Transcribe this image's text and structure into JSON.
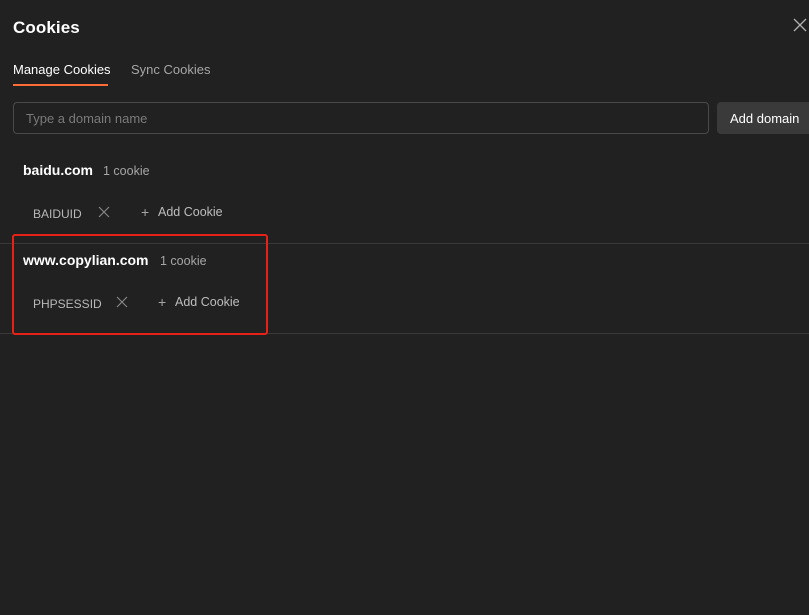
{
  "modal": {
    "title": "Cookies",
    "close_icon": "close-icon"
  },
  "tabs": [
    {
      "label": "Manage Cookies",
      "active": true
    },
    {
      "label": "Sync Cookies",
      "active": false
    }
  ],
  "accent_color": "#ff6c37",
  "highlight_color": "#e62117",
  "domain_input": {
    "placeholder": "Type a domain name",
    "value": ""
  },
  "add_domain_label": "Add domain",
  "domains": [
    {
      "name": "baidu.com",
      "count": "1 cookie",
      "cookies": [
        "BAIDUID"
      ],
      "add_cookie_label": "Add Cookie"
    },
    {
      "name": "www.copylian.com",
      "count": "1 cookie",
      "cookies": [
        "PHPSESSID"
      ],
      "add_cookie_label": "Add Cookie",
      "highlighted": true
    }
  ]
}
